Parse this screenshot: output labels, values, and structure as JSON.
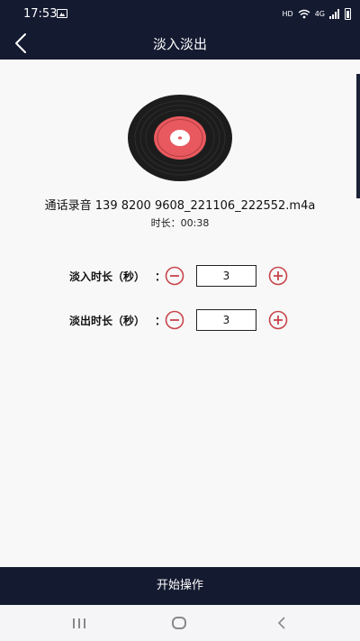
{
  "status_bar": {
    "time": "17:53",
    "network_label": "HD",
    "mobile_data_label": "4G"
  },
  "header": {
    "title": "淡入淡出"
  },
  "audio": {
    "file_name": "通话录音 139 8200 9608_221106_222552.m4a",
    "duration": "时长：00:38"
  },
  "fade_in": {
    "label": "淡入时长（秒）",
    "colon": "：",
    "value": "3"
  },
  "fade_out": {
    "label": "淡出时长（秒）",
    "colon": "：",
    "value": "3"
  },
  "footer": {
    "start_label": "开始操作"
  },
  "colors": {
    "dark_navy": "#141a30",
    "accent_red": "#c8444a",
    "vinyl_red": "#e8595f"
  }
}
